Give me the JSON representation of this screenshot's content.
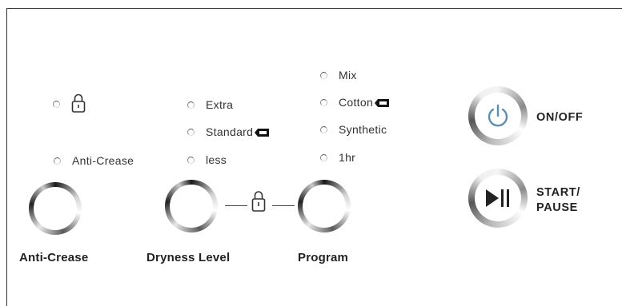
{
  "anti_crease": {
    "lock_led_icon": "lock-icon",
    "option_label": "Anti-Crease",
    "title": "Anti-Crease"
  },
  "dryness": {
    "options": [
      "Extra",
      "Standard",
      "less"
    ],
    "title": "Dryness Level"
  },
  "program": {
    "options": [
      "Mix",
      "Cotton",
      "Synthetic",
      "1hr"
    ],
    "title": "Program"
  },
  "child_lock_icon": "lock-icon",
  "default_marker_icon": "flag-marker-icon",
  "buttons": {
    "power_label": "ON/OFF",
    "start_label_line1": "START/",
    "start_label_line2": "PAUSE"
  },
  "colors": {
    "text": "#222222",
    "accent_power": "#5b8fb0",
    "background": "#ffffff"
  }
}
